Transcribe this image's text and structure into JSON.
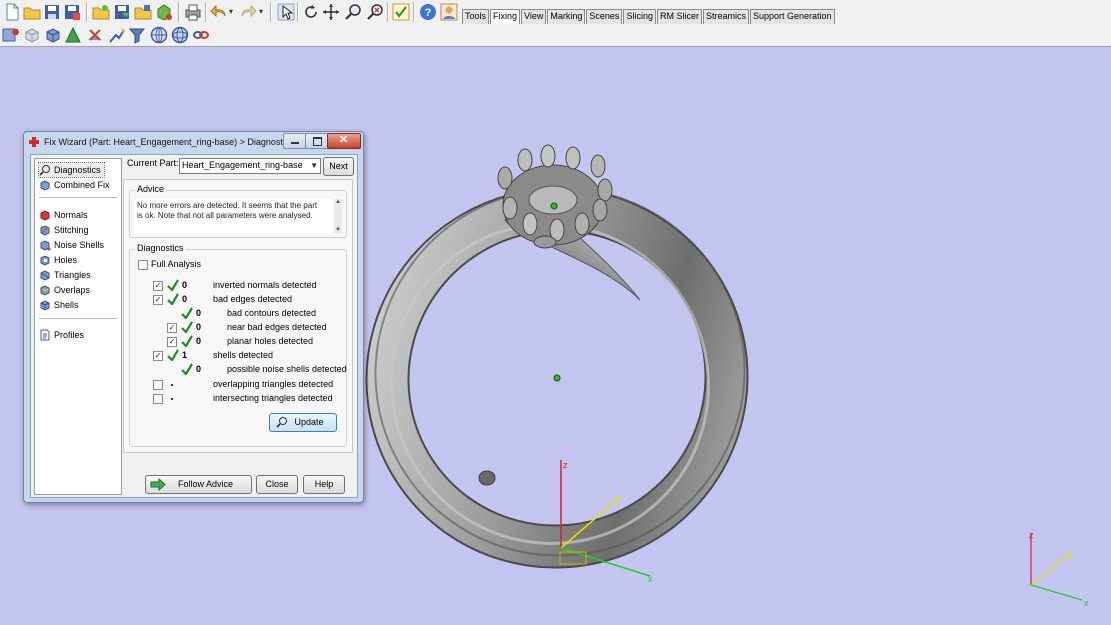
{
  "toolbar": {
    "tabs": [
      "Tools",
      "Fixing",
      "View",
      "Marking",
      "Scenes",
      "Slicing",
      "RM Slicer",
      "Streamics",
      "Support Generation"
    ],
    "active_tab": "Fixing"
  },
  "dialog": {
    "title": "Fix Wizard (Part: Heart_Engagement_ring-base) > Diagnostics",
    "nav": {
      "group1": [
        "Diagnostics",
        "Combined Fix"
      ],
      "group2": [
        "Normals",
        "Stitching",
        "Noise Shells",
        "Holes",
        "Triangles",
        "Overlaps",
        "Shells"
      ],
      "group3": [
        "Profiles"
      ]
    },
    "current_part_label": "Current Part:",
    "current_part_value": "Heart_Engagement_ring-base",
    "next_label": "Next",
    "advice_title": "Advice",
    "advice_text_1": "No more errors are detected. It seems that the part",
    "advice_text_2": "is ok. Note that not all parameters were analysed.",
    "diagnostics_title": "Diagnostics",
    "full_analysis_label": "Full Analysis",
    "rows": [
      {
        "checkbox": true,
        "ok": true,
        "count": "0",
        "label": "inverted normals detected",
        "level": 0
      },
      {
        "checkbox": true,
        "ok": true,
        "count": "0",
        "label": "bad edges detected",
        "level": 0
      },
      {
        "checkbox": false,
        "ok": true,
        "count": "0",
        "label": "bad contours detected",
        "level": 1
      },
      {
        "checkbox": true,
        "ok": true,
        "count": "0",
        "label": "near bad edges detected",
        "level": 1
      },
      {
        "checkbox": true,
        "ok": true,
        "count": "0",
        "label": "planar holes detected",
        "level": 1
      },
      {
        "checkbox": true,
        "ok": true,
        "count": "1",
        "label": "shells detected",
        "level": 0
      },
      {
        "checkbox": false,
        "ok": true,
        "count": "0",
        "label": "possible noise shells detected",
        "level": 1
      },
      {
        "checkbox": true,
        "ok": false,
        "count": "",
        "label": "overlapping triangles detected",
        "level": 0
      },
      {
        "checkbox": true,
        "ok": false,
        "count": "",
        "label": "intersecting triangles detected",
        "level": 0
      }
    ],
    "update_label": "Update",
    "follow_advice_label": "Follow Advice",
    "close_label": "Close",
    "help_label": "Help"
  },
  "viewport": {
    "axis_labels": {
      "x": "x",
      "y": "y",
      "z": "z"
    },
    "background_color": "#c4c4f0"
  }
}
